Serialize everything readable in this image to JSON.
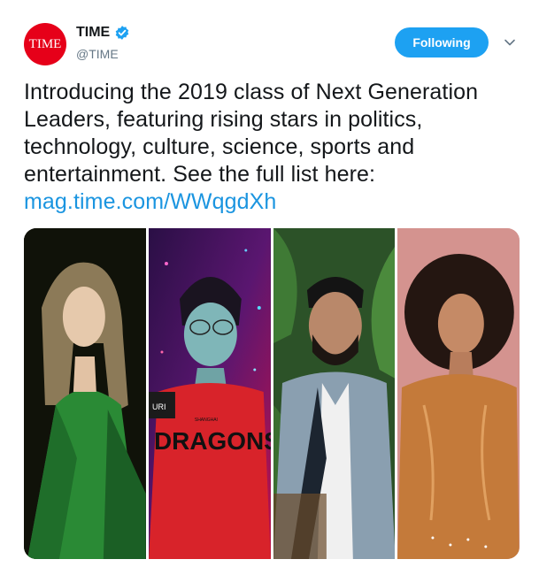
{
  "account": {
    "avatar_text": "TIME",
    "name": "TIME",
    "handle": "@TIME",
    "verified": true,
    "avatar_color": "#e60019"
  },
  "actions": {
    "follow_label": "Following",
    "menu_icon": "chevron-down-icon"
  },
  "tweet": {
    "text": "Introducing the 2019 class of Next Generation Leaders, featuring rising stars in politics, technology, culture, science, sports and entertainment. See the full list here:",
    "link": "mag.time.com/WWqgdXh",
    "link_color": "#1b95e0"
  },
  "media": {
    "jersey_text": "DRAGONS",
    "jersey_subtext": "SHANGHAI",
    "jersey_sleeve": "URI"
  },
  "colors": {
    "accent": "#1da1f2",
    "text": "#14171a",
    "muted": "#657786"
  }
}
